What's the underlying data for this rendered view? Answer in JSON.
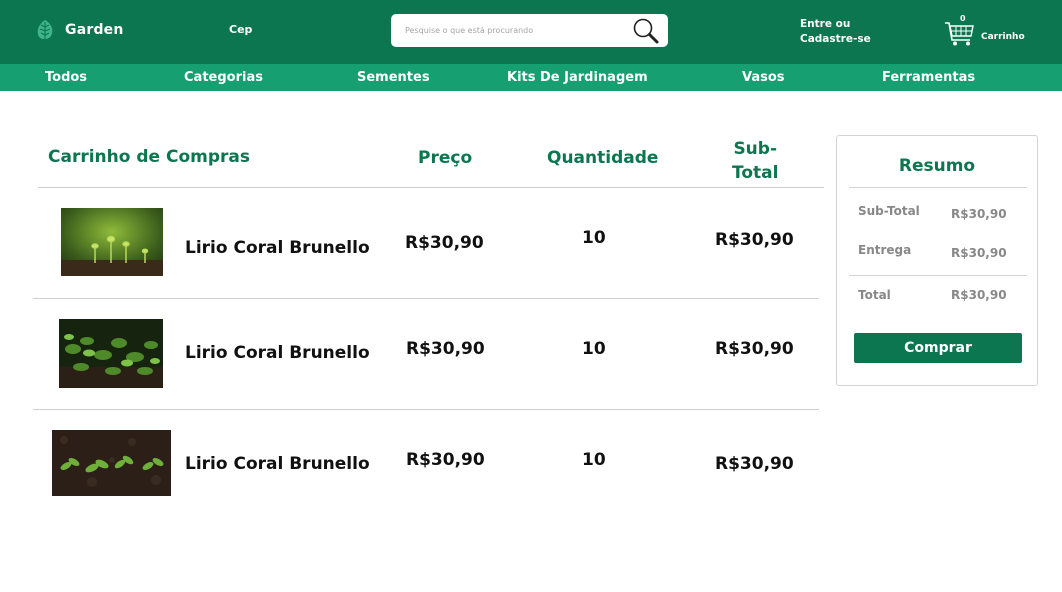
{
  "header": {
    "logo_text": "Garden",
    "cep_label": "Cep",
    "search_placeholder": "Pesquise o que está procurando",
    "login_line1": "Entre ou",
    "login_line2": "Cadastre-se",
    "cart_label": "Carrinho",
    "cart_count": "0"
  },
  "nav": {
    "categories": [
      "Todos",
      "Categorias",
      "Sementes",
      "Kits De Jardinagem",
      "Vasos",
      "Ferramentas"
    ]
  },
  "cart": {
    "title": "Carrinho de Compras",
    "col_price": "Preço",
    "col_qty": "Quantidade",
    "col_subtotal_1": "Sub-",
    "col_subtotal_2": "Total",
    "items": [
      {
        "name": "Lirio Coral Brunello",
        "price": "R$30,90",
        "qty": "10",
        "subtotal": "R$30,90"
      },
      {
        "name": "Lirio Coral Brunello",
        "price": "R$30,90",
        "qty": "10",
        "subtotal": "R$30,90"
      },
      {
        "name": "Lirio Coral Brunello",
        "price": "R$30,90",
        "qty": "10",
        "subtotal": "R$30,90"
      }
    ]
  },
  "summary": {
    "title": "Resumo",
    "subtotal_label": "Sub-Total",
    "subtotal_value": "R$30,90",
    "delivery_label": "Entrega",
    "delivery_value": "R$30,90",
    "total_label": "Total",
    "total_value": "R$30,90",
    "buy_label": "Comprar"
  },
  "colors": {
    "header_bg": "#0b7650",
    "nav_bg": "#16a072",
    "accent": "#0b7650"
  }
}
